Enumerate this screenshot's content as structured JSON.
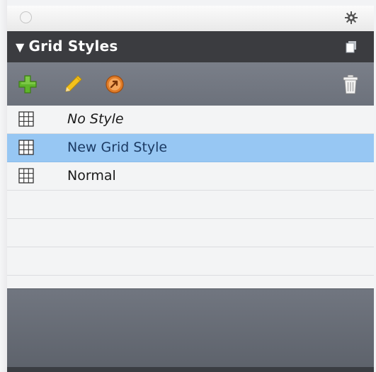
{
  "panel": {
    "title": "Grid Styles",
    "collapse_glyph": "▼",
    "settings_icon": "gear-icon",
    "menu_icon": "panel-menu-icon"
  },
  "toolbar": {
    "buttons": [
      {
        "name": "add-style-button",
        "icon": "plus-icon",
        "color": "#5fb52a"
      },
      {
        "name": "edit-style-button",
        "icon": "pencil-icon",
        "color": "#f4c21c"
      },
      {
        "name": "apply-style-button",
        "icon": "apply-icon",
        "color": "#e07b26"
      },
      {
        "name": "delete-style-button",
        "icon": "trash-icon",
        "color": "#f0f0f0"
      }
    ]
  },
  "styles": {
    "items": [
      {
        "label": "No Style",
        "italic": true,
        "selected": false
      },
      {
        "label": "New Grid Style",
        "italic": false,
        "selected": true
      },
      {
        "label": "Normal",
        "italic": false,
        "selected": false
      }
    ]
  },
  "colors": {
    "header_bg": "#3b3c40",
    "toolbar_bg": "#747983",
    "selection": "#97c7f3",
    "list_bg": "#f3f4f5"
  }
}
